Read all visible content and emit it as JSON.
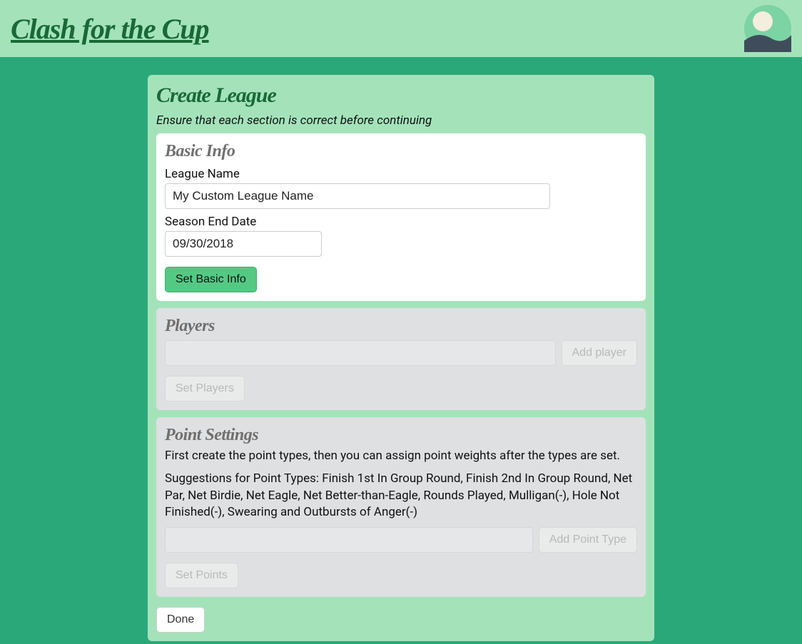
{
  "header": {
    "site_title": "Clash for the Cup"
  },
  "page": {
    "title": "Create League",
    "subtitle": "Ensure that each section is correct before continuing"
  },
  "basic_info": {
    "section_title": "Basic Info",
    "league_name_label": "League Name",
    "league_name_value": "My Custom League Name",
    "season_end_label": "Season End Date",
    "season_end_value": "09/30/2018",
    "set_button": "Set Basic Info"
  },
  "players": {
    "section_title": "Players",
    "add_button": "Add player",
    "set_button": "Set Players"
  },
  "points": {
    "section_title": "Point Settings",
    "instructions": "First create the point types, then you can assign point weights after the types are set.",
    "suggestions": "Suggestions for Point Types: Finish 1st In Group Round, Finish 2nd In Group Round, Net Par, Net Birdie, Net Eagle, Net Better-than-Eagle, Rounds Played, Mulligan(-), Hole Not Finished(-), Swearing and Outbursts of Anger(-)",
    "add_button": "Add Point Type",
    "set_button": "Set Points"
  },
  "done": {
    "label": "Done"
  }
}
